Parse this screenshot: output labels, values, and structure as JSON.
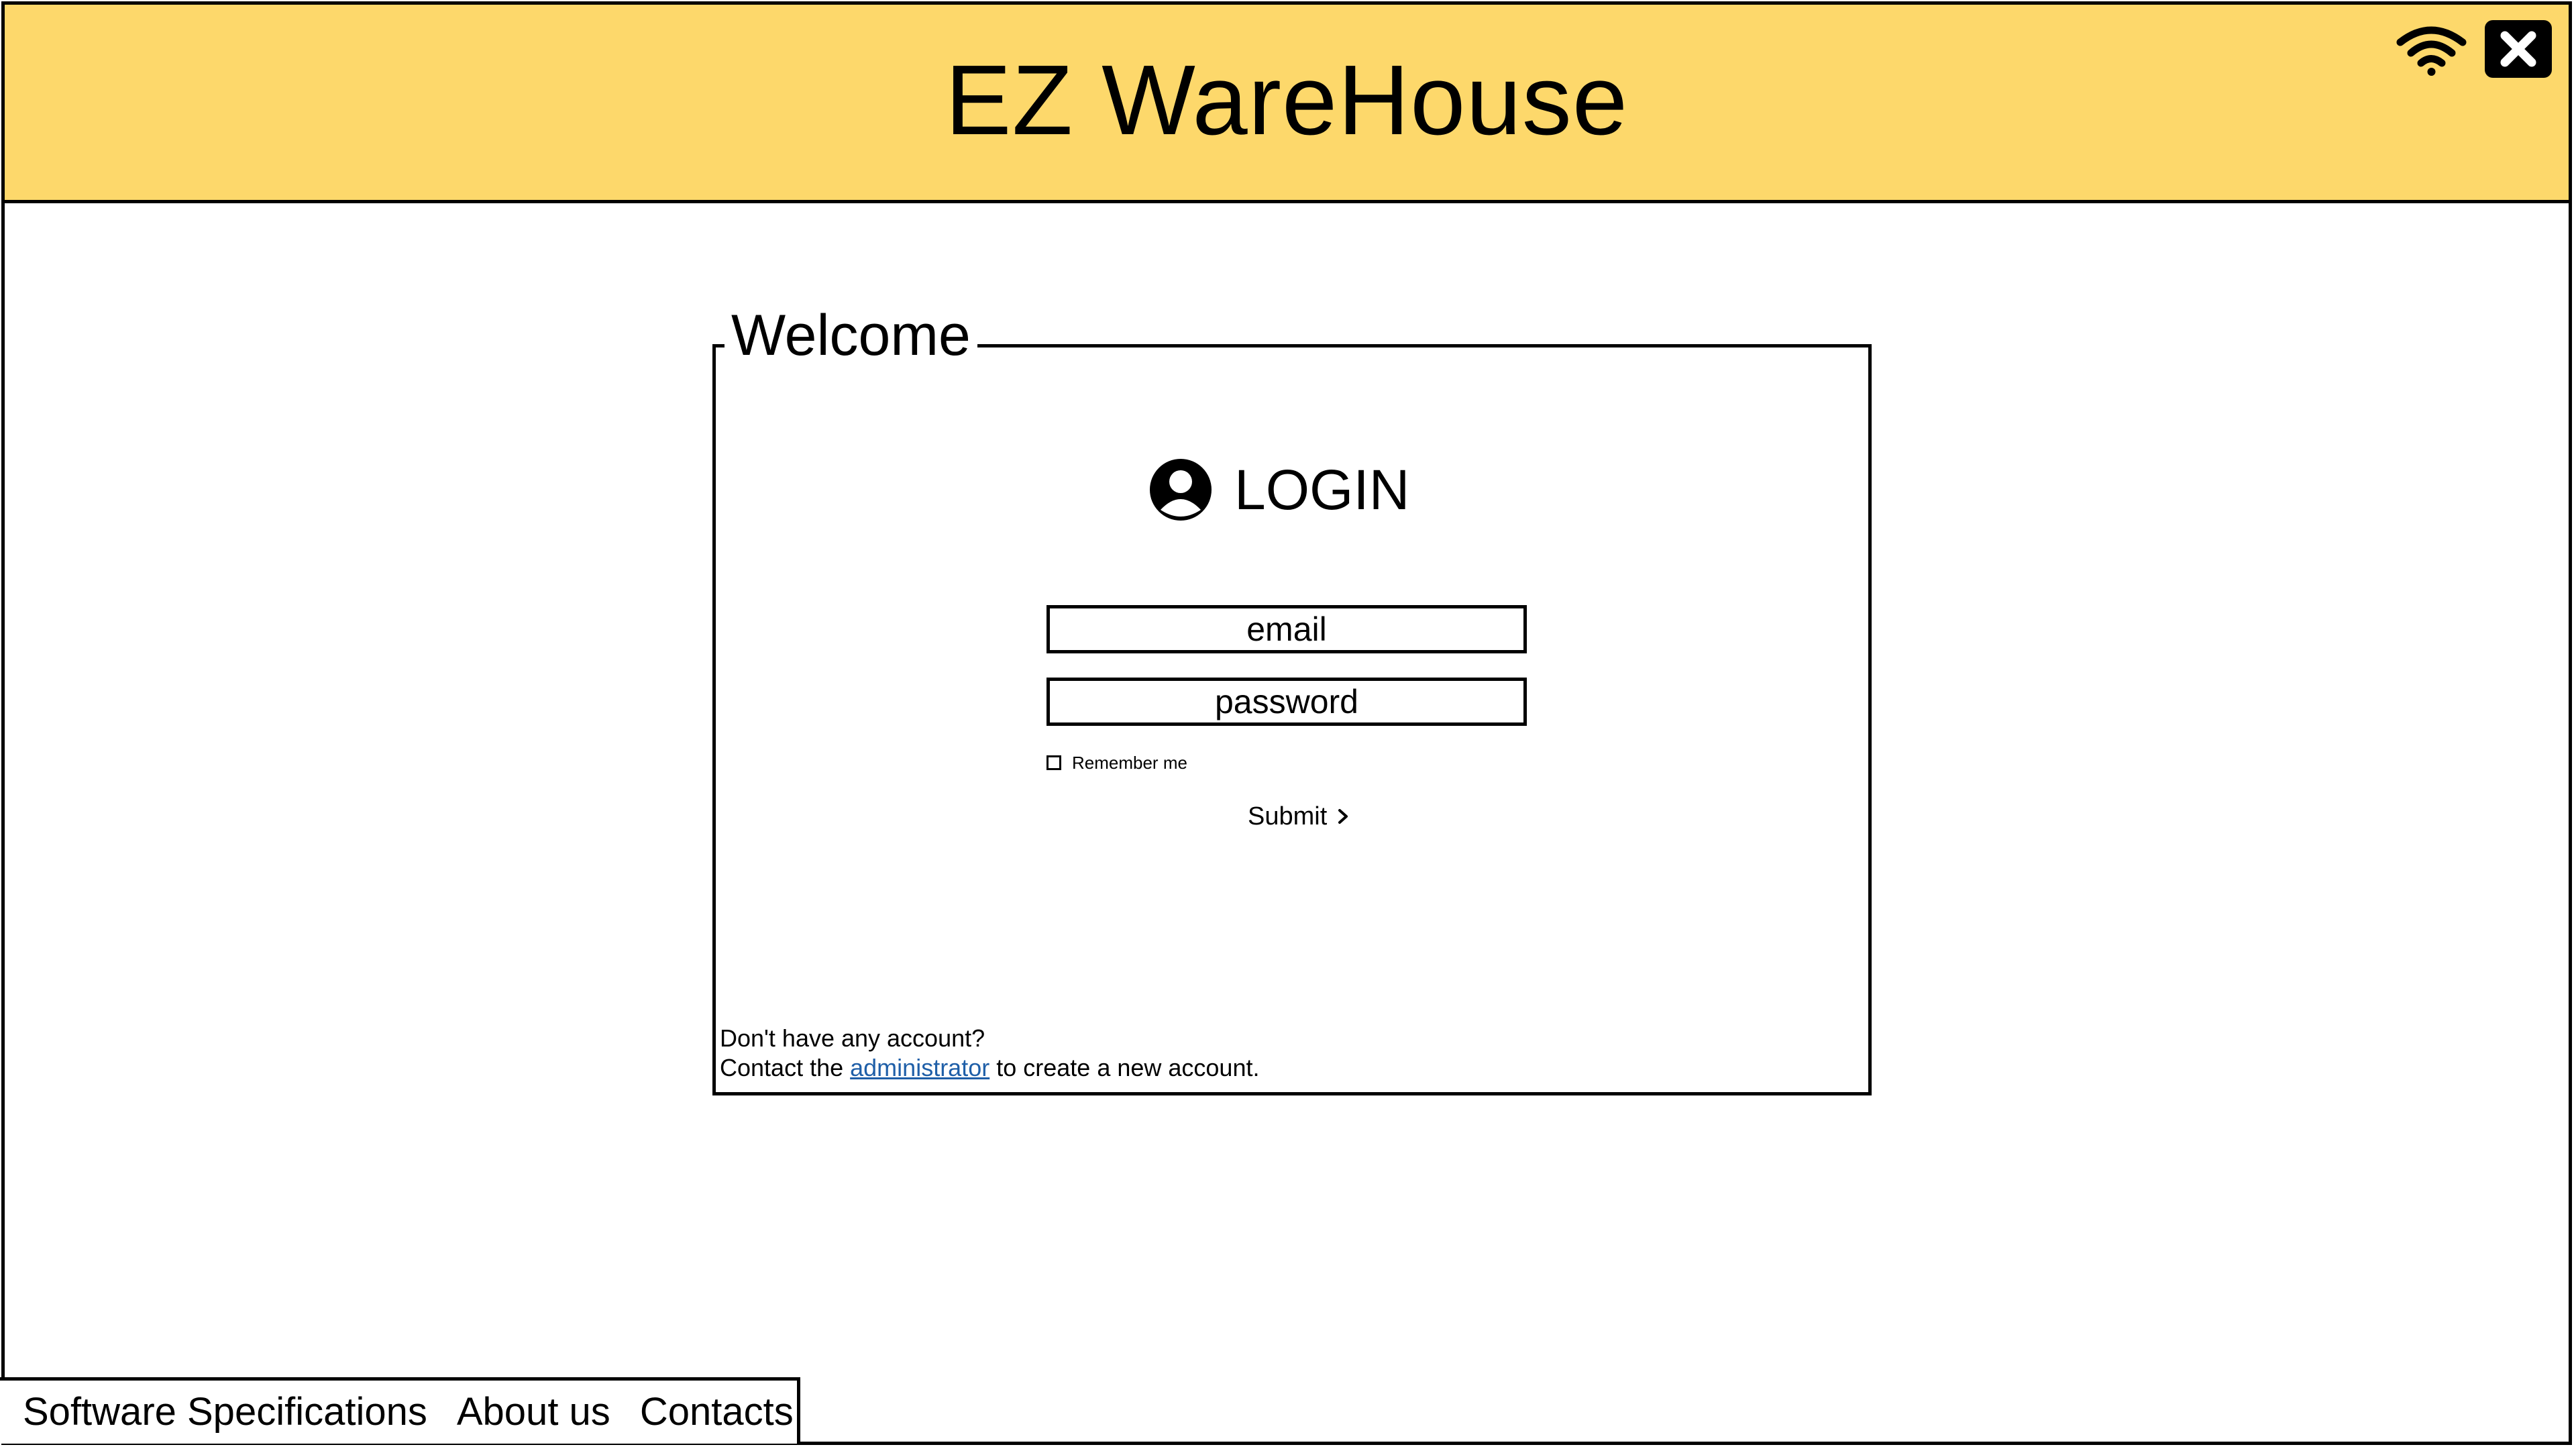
{
  "header": {
    "title": "EZ WareHouse",
    "background_color": "#fdd86b",
    "icons": [
      "wifi-icon",
      "close-icon"
    ]
  },
  "welcome": {
    "legend": "Welcome",
    "login_label": "LOGIN",
    "login_icon": "user-circle-icon",
    "email_placeholder": "email",
    "password_placeholder": "password",
    "remember_label": "Remember me",
    "remember_checked": false,
    "submit_label": "Submit",
    "note_line1": "Don't have any account?",
    "note_prefix": "Contact the",
    "note_link": "administrator",
    "note_suffix": "to create a new account.",
    "link_color": "#1f5fa8"
  },
  "footer": {
    "links": [
      "Software Specifications",
      "About us",
      "Contacts"
    ]
  }
}
